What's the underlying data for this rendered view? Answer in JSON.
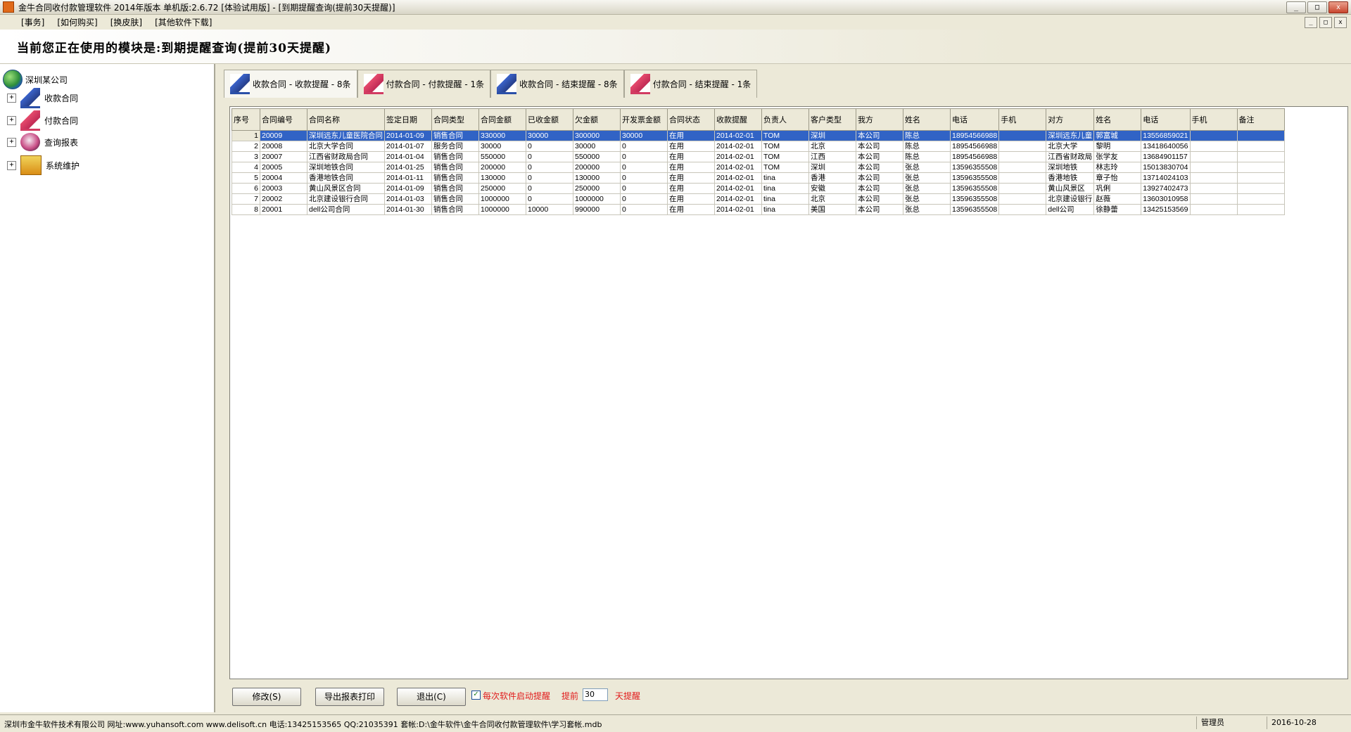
{
  "window": {
    "title": "金牛合同收付款管理软件 2014年版本 单机版:2.6.72 [体验试用版] - [到期提醒查询(提前30天提醒)]",
    "buttons": [
      "_",
      "□",
      "x"
    ]
  },
  "menu": {
    "items": [
      "[事务]",
      "[如何购买]",
      "[换皮肤]",
      "[其他软件下载]"
    ],
    "mdi_buttons": [
      "_",
      "□",
      "x"
    ]
  },
  "banner": {
    "text": "当前您正在使用的模块是:到期提醒查询(提前30天提醒)"
  },
  "tree": {
    "root": "深圳某公司",
    "nodes": [
      {
        "label": "收款合同",
        "icon": "pen-blue-icon"
      },
      {
        "label": "付款合同",
        "icon": "pen-red-icon"
      },
      {
        "label": "查询报表",
        "icon": "report-icon"
      },
      {
        "label": "系统维护",
        "icon": "maintenance-icon"
      }
    ],
    "expander": "+"
  },
  "tabs": [
    {
      "label": "收款合同 - 收款提醒 - 8条"
    },
    {
      "label": "付款合同 - 付款提醒 - 1条"
    },
    {
      "label": "收款合同 - 结束提醒 - 8条"
    },
    {
      "label": "付款合同 - 结束提醒 - 1条"
    }
  ],
  "grid": {
    "columns": [
      "序号",
      "合同编号",
      "合同名称",
      "签定日期",
      "合同类型",
      "合同金额",
      "已收金额",
      "欠金额",
      "开发票金额",
      "合同状态",
      "收款提醒",
      "负责人",
      "客户类型",
      "我方",
      "姓名",
      "电话",
      "手机",
      "对方",
      "姓名",
      "电话",
      "手机",
      "备注"
    ],
    "rows": [
      [
        "1",
        "20009",
        "深圳远东儿童医院合同",
        "2014-01-09",
        "销售合同",
        "330000",
        "30000",
        "300000",
        "30000",
        "在用",
        "2014-02-01",
        "TOM",
        "深圳",
        "本公司",
        "陈总",
        "18954566988",
        "",
        "深圳远东儿童",
        "郭富城",
        "13556859021",
        "",
        ""
      ],
      [
        "2",
        "20008",
        "北京大学合同",
        "2014-01-07",
        "服务合同",
        "30000",
        "0",
        "30000",
        "0",
        "在用",
        "2014-02-01",
        "TOM",
        "北京",
        "本公司",
        "陈总",
        "18954566988",
        "",
        "北京大学",
        "黎明",
        "13418640056",
        "",
        ""
      ],
      [
        "3",
        "20007",
        "江西省财政局合同",
        "2014-01-04",
        "销售合同",
        "550000",
        "0",
        "550000",
        "0",
        "在用",
        "2014-02-01",
        "TOM",
        "江西",
        "本公司",
        "陈总",
        "18954566988",
        "",
        "江西省财政局",
        "张学友",
        "13684901157",
        "",
        ""
      ],
      [
        "4",
        "20005",
        "深圳地铁合同",
        "2014-01-25",
        "销售合同",
        "200000",
        "0",
        "200000",
        "0",
        "在用",
        "2014-02-01",
        "TOM",
        "深圳",
        "本公司",
        "张总",
        "13596355508",
        "",
        "深圳地铁",
        "林志玲",
        "15013830704",
        "",
        ""
      ],
      [
        "5",
        "20004",
        "香港地铁合同",
        "2014-01-11",
        "销售合同",
        "130000",
        "0",
        "130000",
        "0",
        "在用",
        "2014-02-01",
        "tina",
        "香港",
        "本公司",
        "张总",
        "13596355508",
        "",
        "香港地铁",
        "章子怡",
        "13714024103",
        "",
        ""
      ],
      [
        "6",
        "20003",
        "黄山风景区合同",
        "2014-01-09",
        "销售合同",
        "250000",
        "0",
        "250000",
        "0",
        "在用",
        "2014-02-01",
        "tina",
        "安徽",
        "本公司",
        "张总",
        "13596355508",
        "",
        "黄山风景区",
        "巩俐",
        "13927402473",
        "",
        ""
      ],
      [
        "7",
        "20002",
        "北京建设银行合同",
        "2014-01-03",
        "销售合同",
        "1000000",
        "0",
        "1000000",
        "0",
        "在用",
        "2014-02-01",
        "tina",
        "北京",
        "本公司",
        "张总",
        "13596355508",
        "",
        "北京建设银行",
        "赵薇",
        "13603010958",
        "",
        ""
      ],
      [
        "8",
        "20001",
        "dell公司合同",
        "2014-01-30",
        "销售合同",
        "1000000",
        "10000",
        "990000",
        "0",
        "在用",
        "2014-02-01",
        "tina",
        "美国",
        "本公司",
        "张总",
        "13596355508",
        "",
        "dell公司",
        "徐静蕾",
        "13425153569",
        "",
        ""
      ]
    ]
  },
  "bottom": {
    "modify_btn": "修改(S)",
    "export_btn": "导出报表打印",
    "exit_btn": "退出(C)",
    "checkbox_label": "每次软件启动提醒",
    "checkbox_mark": "✓",
    "advance_label": "提前",
    "days_value": "30",
    "days_label": "天提醒"
  },
  "status": {
    "main": "深圳市金牛软件技术有限公司 网址:www.yuhansoft.com www.delisoft.cn 电话:13425153565 QQ:21035391 套帐:D:\\金牛软件\\金牛合同收付款管理软件\\学习套帐.mdb",
    "user": "管理员",
    "date": "2016-10-28"
  },
  "colors": {
    "selection": "#3163c5",
    "alert_text": "#e11a1a"
  }
}
